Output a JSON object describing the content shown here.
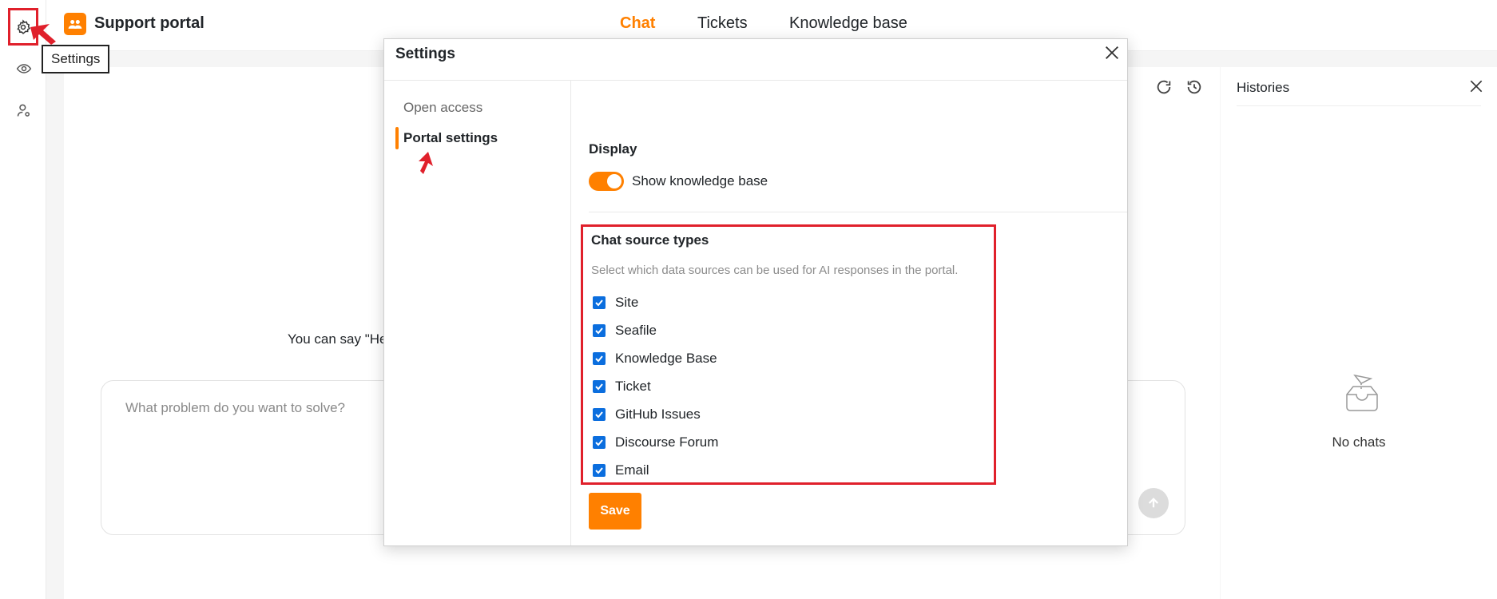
{
  "app": {
    "brand": "Support portal",
    "nav": [
      {
        "label": "Chat",
        "active": true
      },
      {
        "label": "Tickets",
        "active": false
      },
      {
        "label": "Knowledge base",
        "active": false
      }
    ],
    "accent_color": "#ff8000"
  },
  "rail": {
    "items": [
      "gear-icon",
      "eye-icon",
      "user-settings-icon"
    ],
    "tooltip": "Settings"
  },
  "chat": {
    "hint": "You can say \"He",
    "input_placeholder": "What problem do you want to solve?"
  },
  "histories": {
    "title": "Histories",
    "empty_text": "No chats"
  },
  "settings_modal": {
    "title": "Settings",
    "sidebar": [
      {
        "label": "Open access",
        "active": false
      },
      {
        "label": "Portal settings",
        "active": true
      }
    ],
    "display": {
      "title": "Display",
      "toggle_label": "Show knowledge base",
      "toggle_on": true
    },
    "sources": {
      "title": "Chat source types",
      "description": "Select which data sources can be used for AI responses in the portal.",
      "items": [
        {
          "label": "Site",
          "checked": true
        },
        {
          "label": "Seafile",
          "checked": true
        },
        {
          "label": "Knowledge Base",
          "checked": true
        },
        {
          "label": "Ticket",
          "checked": true
        },
        {
          "label": "GitHub Issues",
          "checked": true
        },
        {
          "label": "Discourse Forum",
          "checked": true
        },
        {
          "label": "Email",
          "checked": true
        }
      ]
    },
    "save_label": "Save"
  }
}
